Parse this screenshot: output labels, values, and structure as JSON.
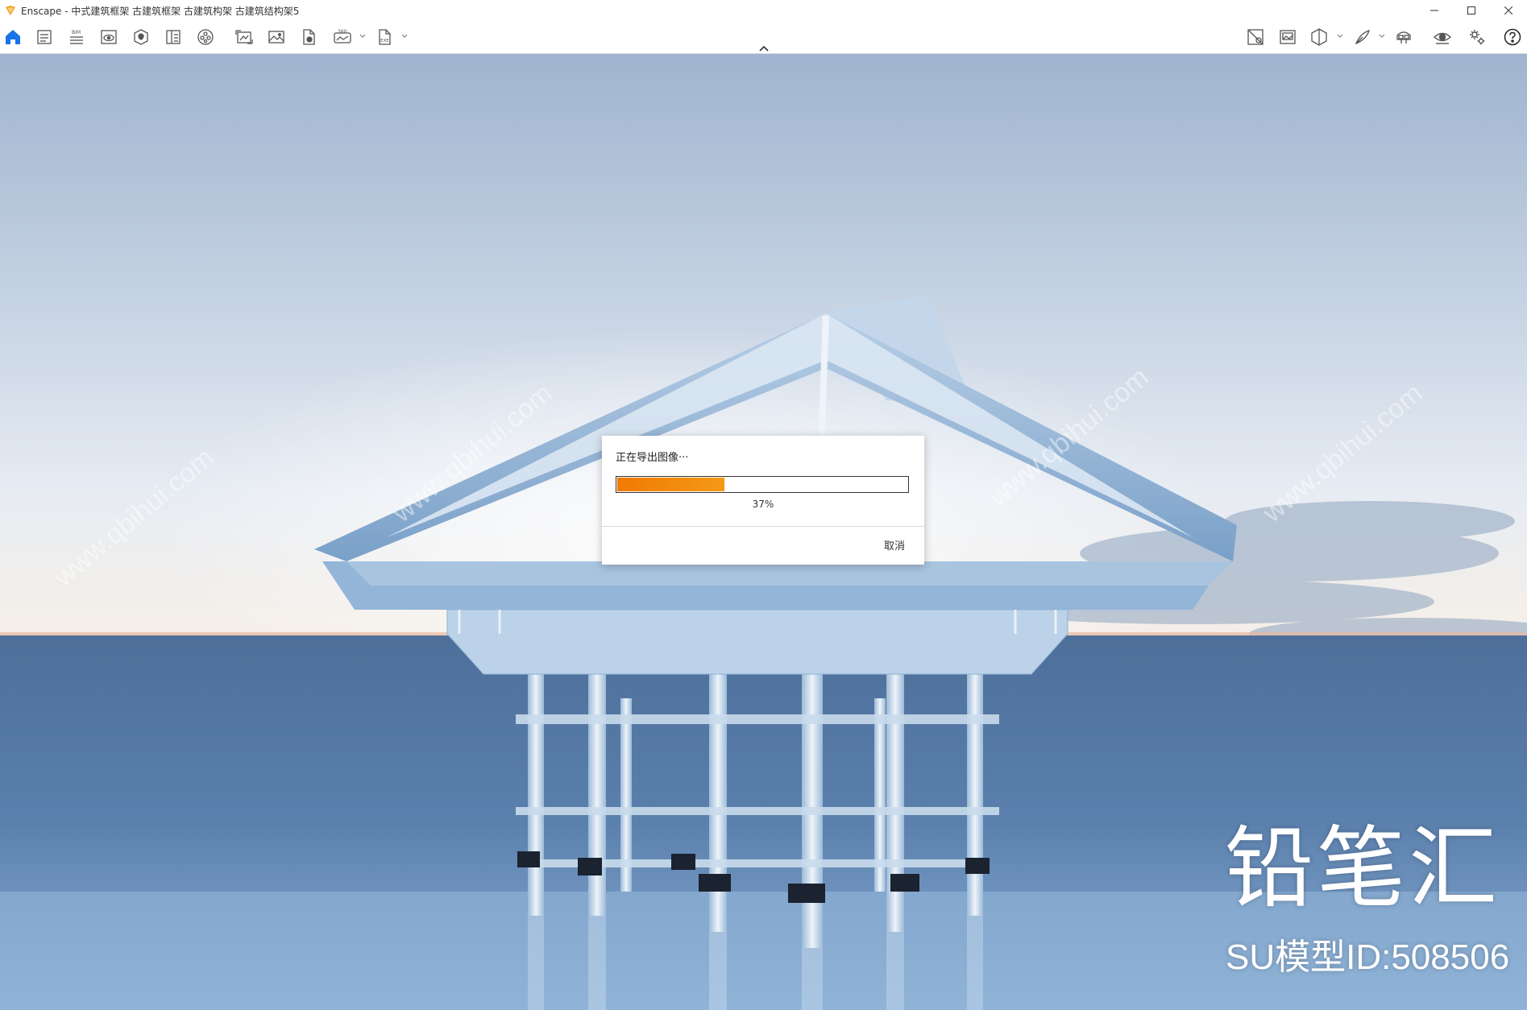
{
  "window": {
    "title": "Enscape - 中式建筑框架 古建筑框架 古建筑构架  古建筑结构架5",
    "controls": [
      "minimize-icon",
      "maximize-icon",
      "close-icon"
    ]
  },
  "toolbar": {
    "left_icons": [
      "home-icon",
      "views-icon",
      "bim-icon",
      "visual-settings-icon",
      "asset-library-icon",
      "material-editor-icon",
      "video-editor-icon",
      "batch-render-icon",
      "screenshot-icon",
      "panorama-icon",
      "export-360-icon",
      "export-exe-icon"
    ],
    "right_icons": [
      "render-mode-icon",
      "capture-icon",
      "section-icon",
      "sketch-icon",
      "vr-headset-icon",
      "visibility-icon",
      "settings-icon",
      "help-icon"
    ],
    "accent_color": "#1a73e8"
  },
  "dialog": {
    "message": "正在导出图像···",
    "progress": 0.37,
    "progress_label": "37%",
    "cancel_label": "取消",
    "progress_color": "#f07a00"
  },
  "watermark": {
    "brand": "铅笔汇",
    "model_id": "SU模型ID:508506",
    "site": "www.qbihui.com"
  }
}
